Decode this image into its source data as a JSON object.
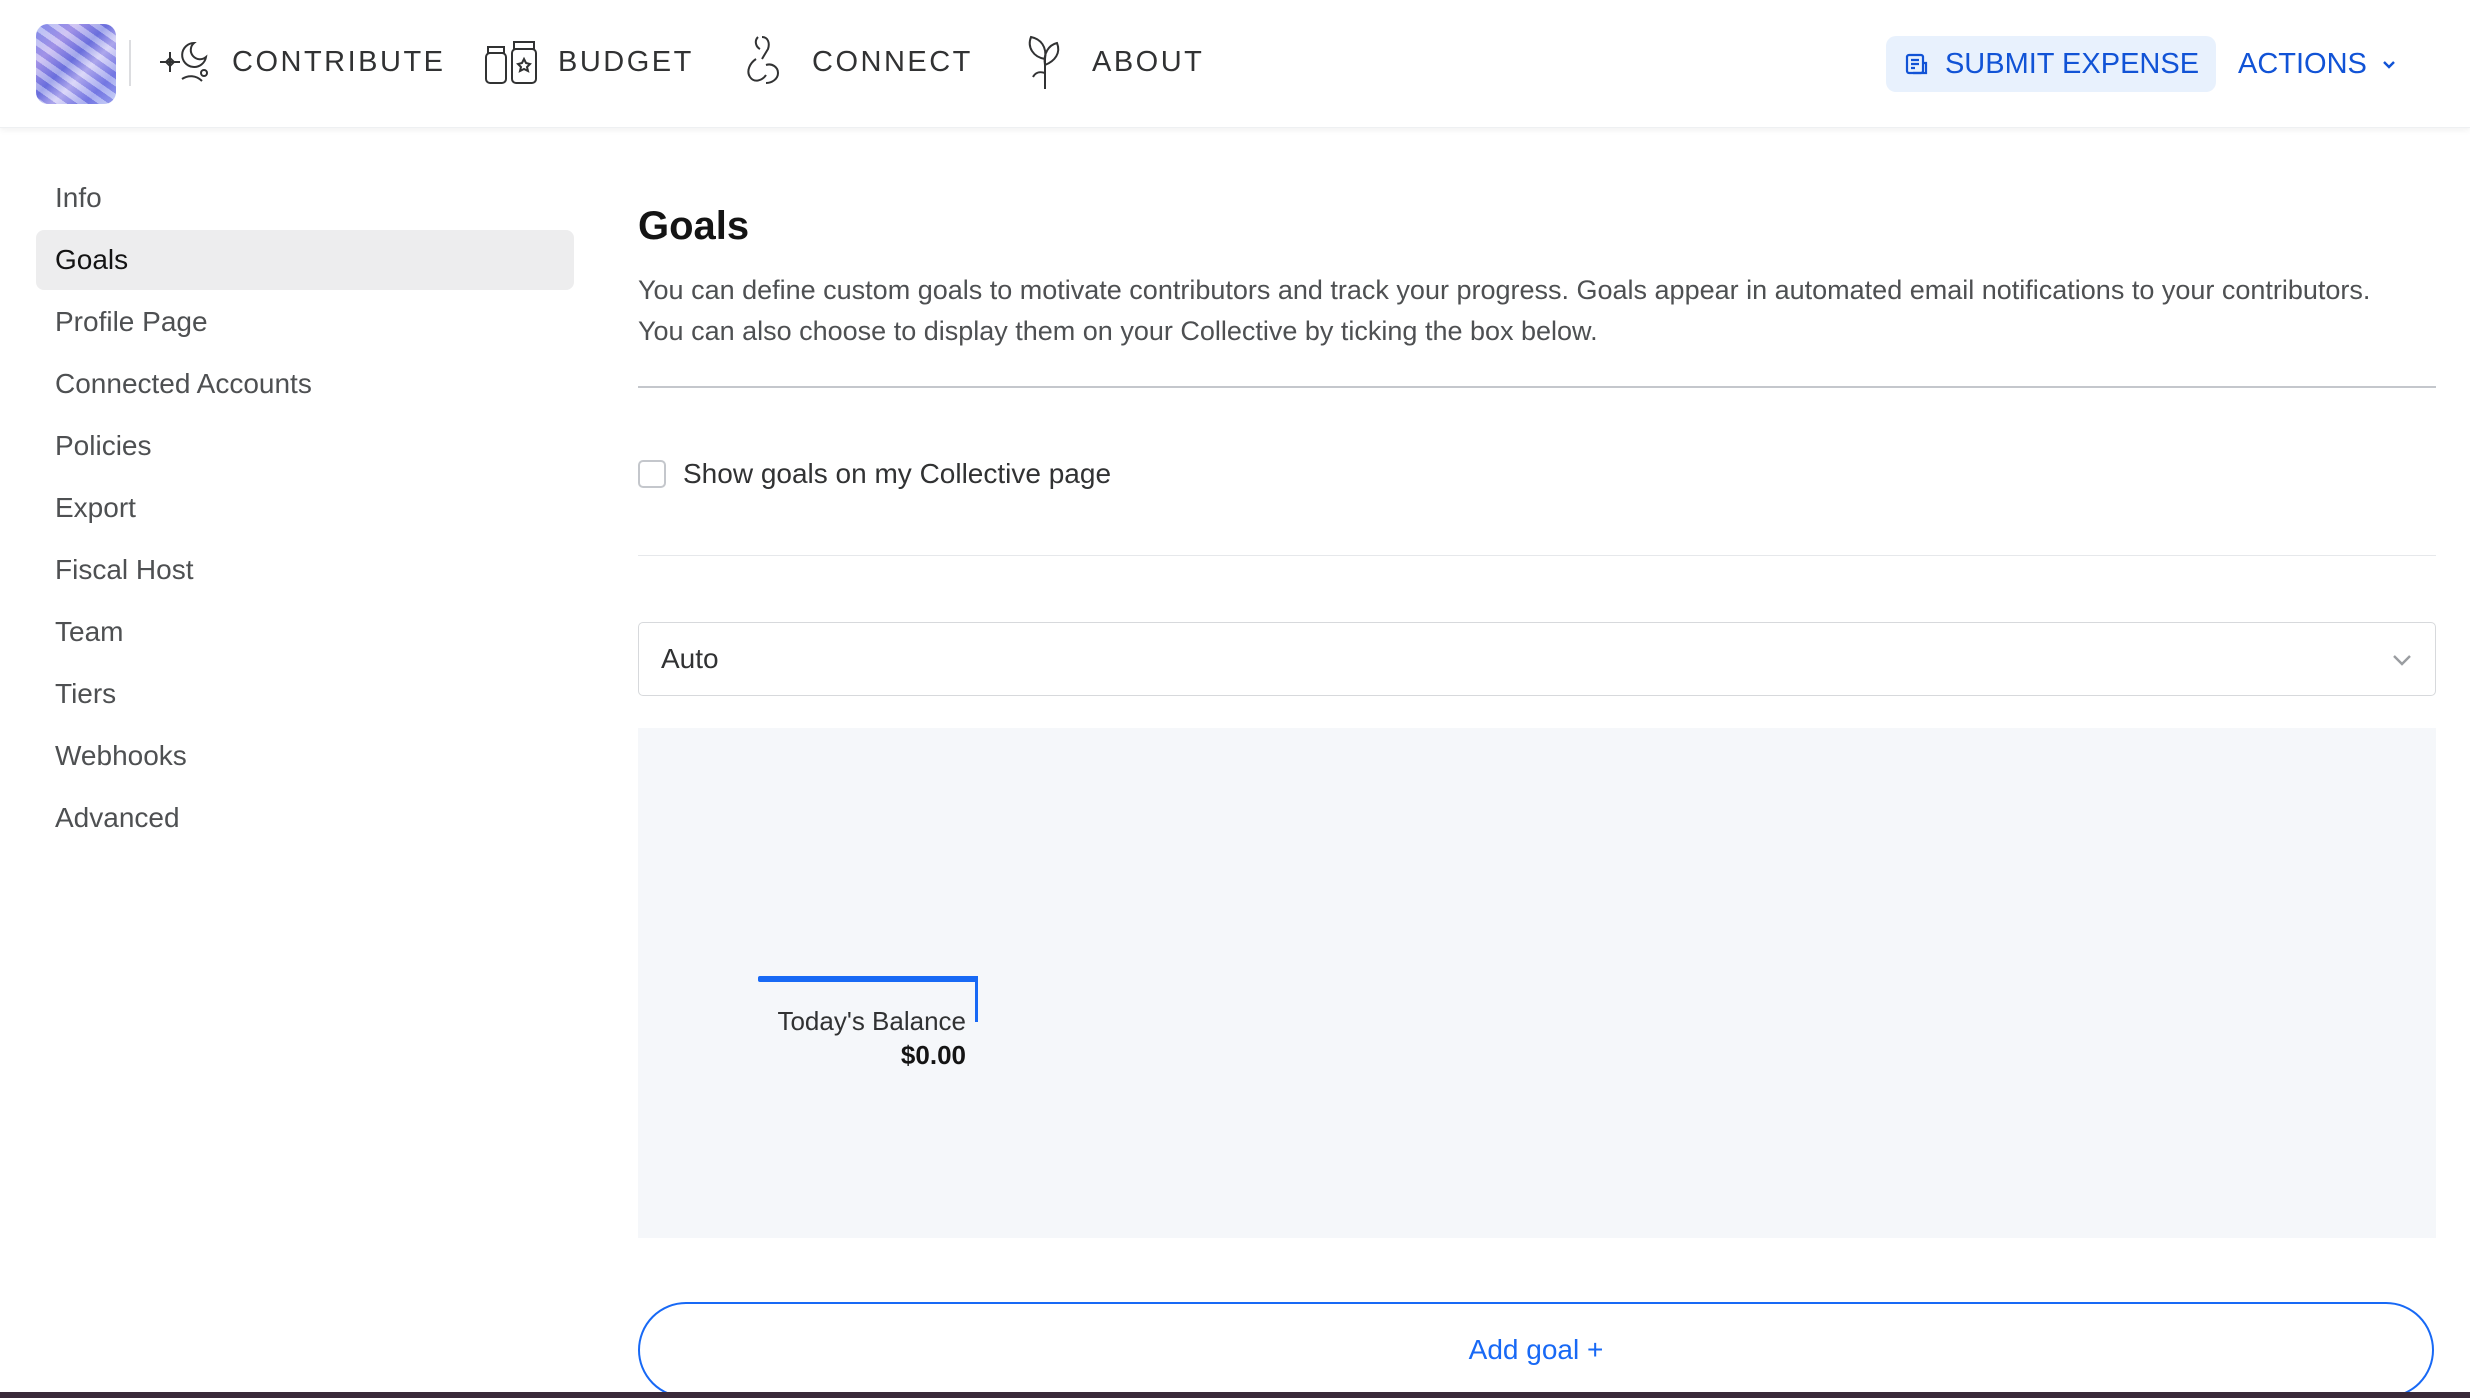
{
  "header": {
    "nav": [
      {
        "label": "CONTRIBUTE",
        "icon": "sparkle-moon-icon"
      },
      {
        "label": "BUDGET",
        "icon": "jars-icon"
      },
      {
        "label": "CONNECT",
        "icon": "handshake-icon"
      },
      {
        "label": "ABOUT",
        "icon": "plant-icon"
      }
    ],
    "submit_expense": "SUBMIT EXPENSE",
    "actions": "ACTIONS"
  },
  "sidebar": {
    "items": [
      "Info",
      "Goals",
      "Profile Page",
      "Connected Accounts",
      "Policies",
      "Export",
      "Fiscal Host",
      "Team",
      "Tiers",
      "Webhooks",
      "Advanced"
    ],
    "active": "Goals"
  },
  "main": {
    "title": "Goals",
    "description": "You can define custom goals to motivate contributors and track your progress. Goals appear in automated email notifications to your contributors. You can also choose to display them on your Collective by ticking the box below.",
    "checkbox_label": "Show goals on my Collective page",
    "checkbox_checked": false,
    "select_value": "Auto",
    "balance_label": "Today's Balance",
    "balance_amount": "$0.00",
    "add_goal": "Add goal +"
  },
  "colors": {
    "accent": "#1869f5",
    "nav_blue": "#1153d6",
    "button_bg": "#e8f1fd",
    "goals_bg": "#f5f7fa"
  }
}
